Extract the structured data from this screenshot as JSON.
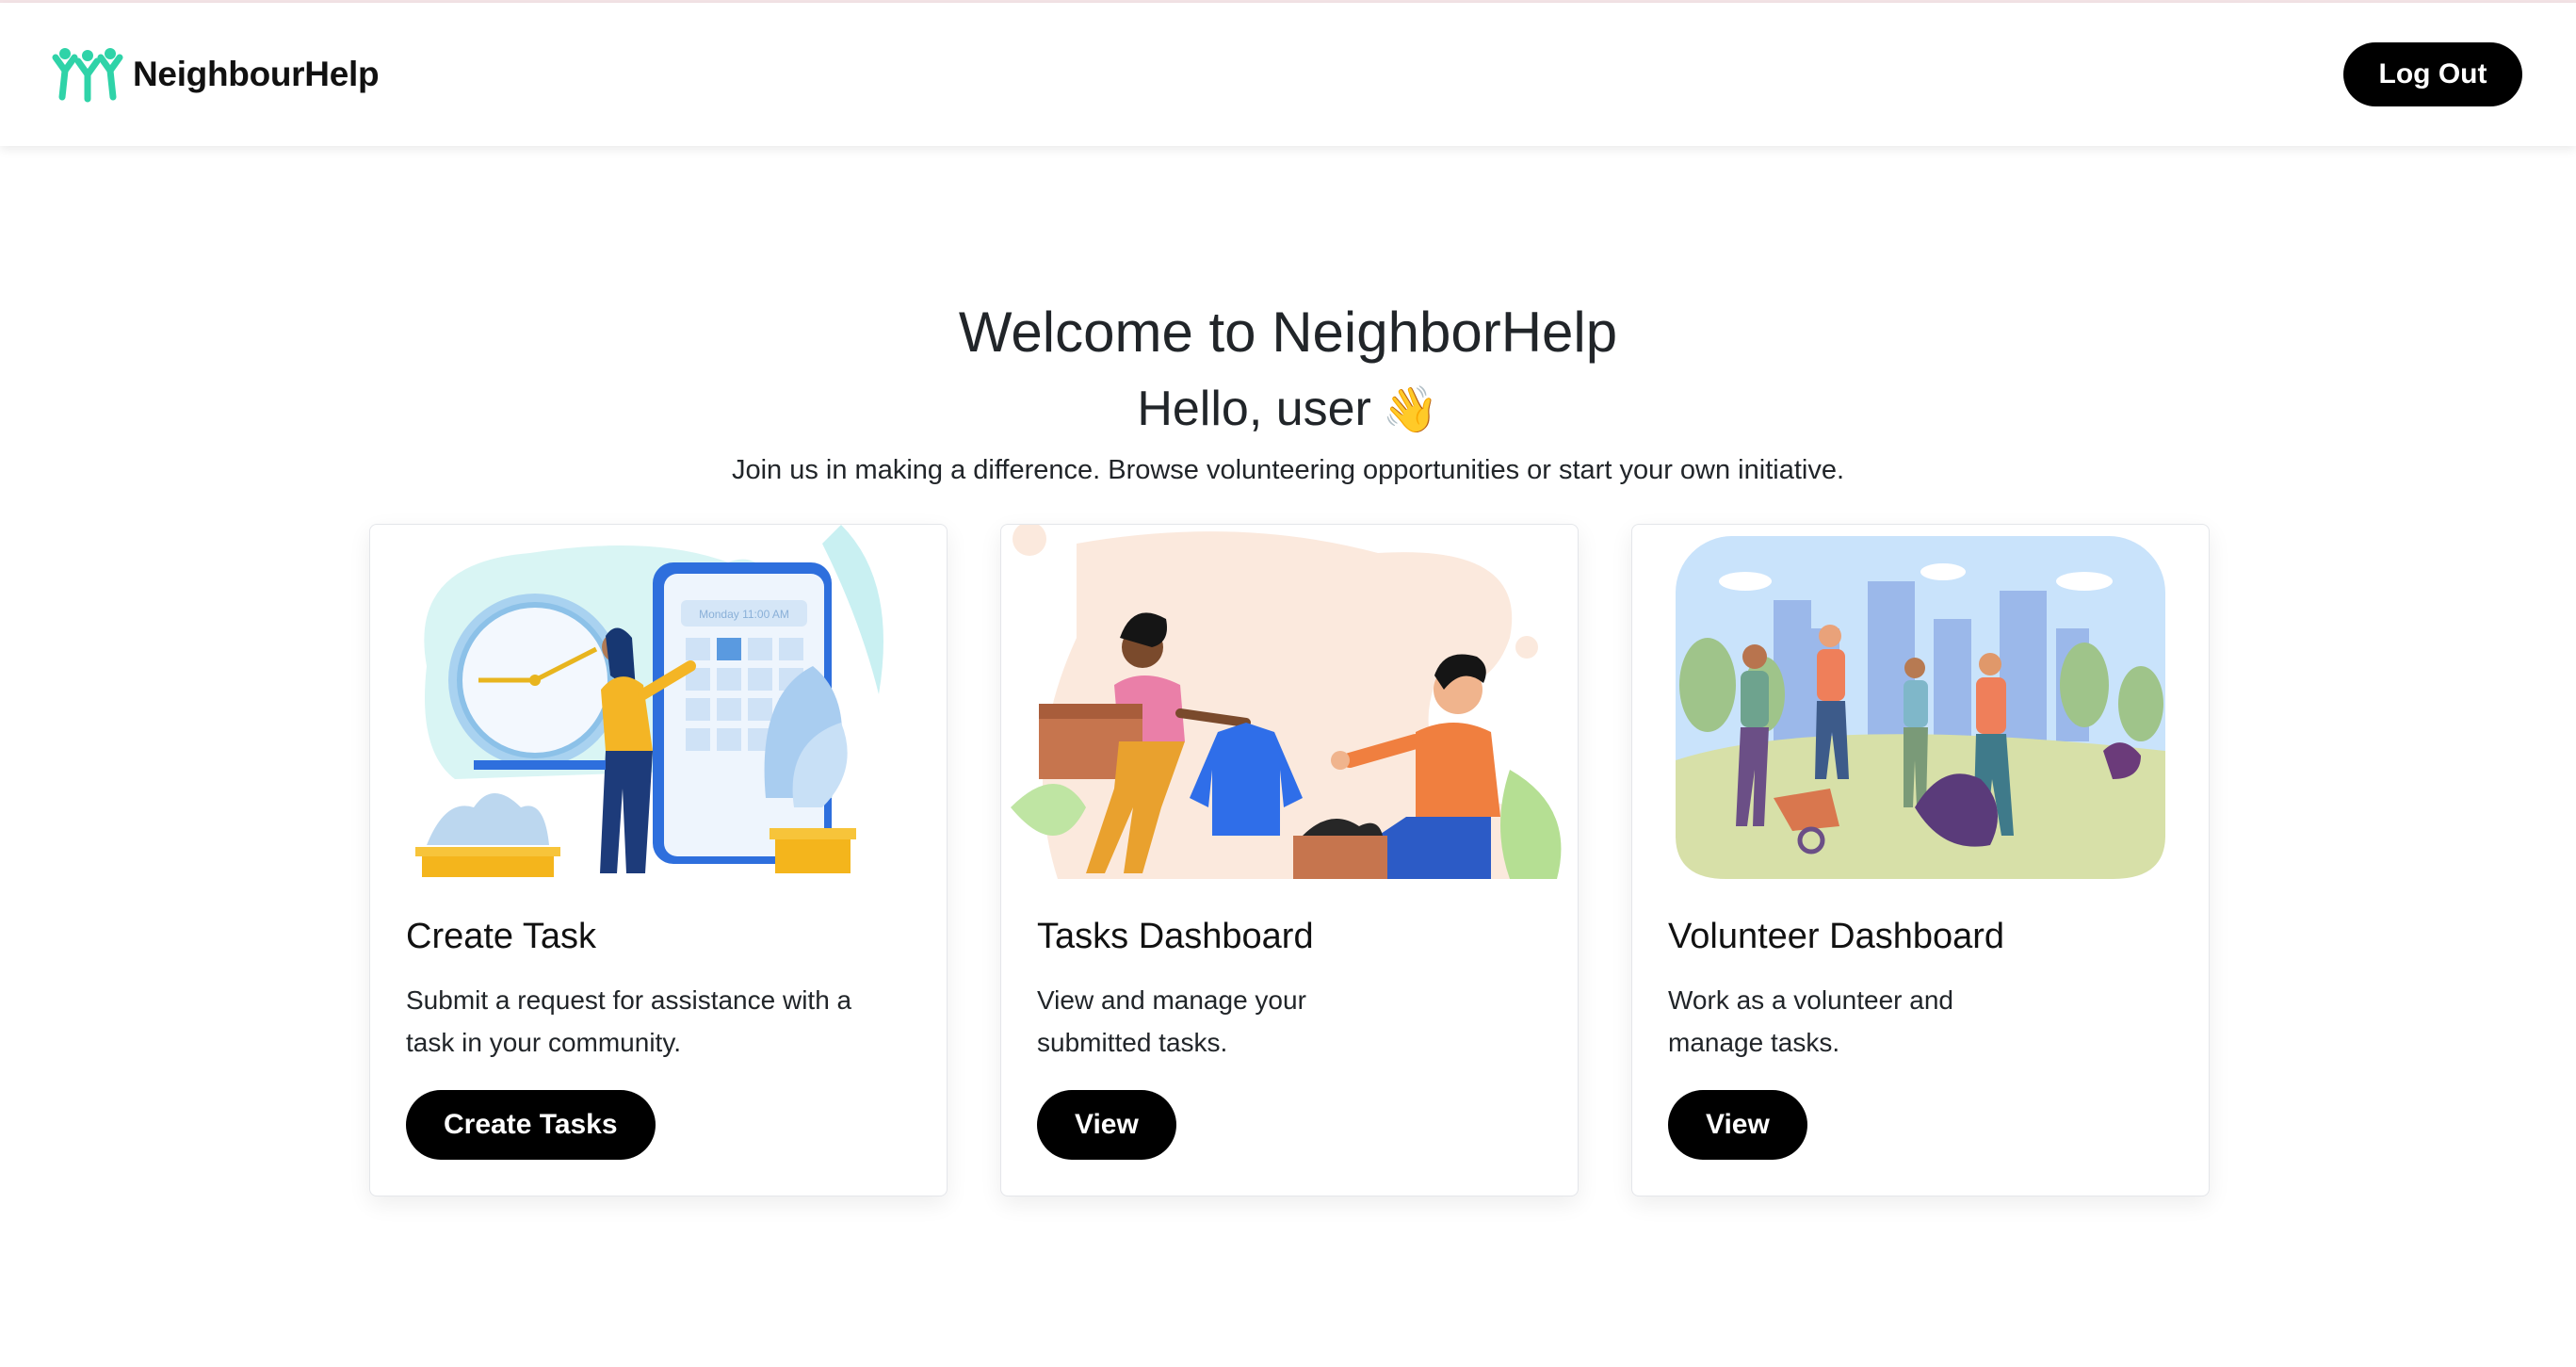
{
  "header": {
    "brand_name": "NeighbourHelp",
    "logout_label": "Log Out"
  },
  "hero": {
    "welcome": "Welcome to NeighborHelp",
    "greeting": "Hello, user",
    "wave_emoji": "👋",
    "intro": "Join us in making a difference. Browse volunteering opportunities or start your own initiative."
  },
  "cards": [
    {
      "title": "Create Task",
      "text_line1": "Submit a request for assistance with a",
      "text_line2": "task in your community.",
      "button": "Create Tasks",
      "illustration_label": "Monday 11:00 AM"
    },
    {
      "title": "Tasks Dashboard",
      "text_line1": "View and manage your",
      "text_line2": "submitted tasks.",
      "button": "View"
    },
    {
      "title": "Volunteer Dashboard",
      "text_line1": "Work as a volunteer and",
      "text_line2": "manage tasks.",
      "button": "View"
    }
  ],
  "colors": {
    "brand_teal": "#2fd3a8",
    "button_bg": "#000000",
    "text": "#212529"
  }
}
